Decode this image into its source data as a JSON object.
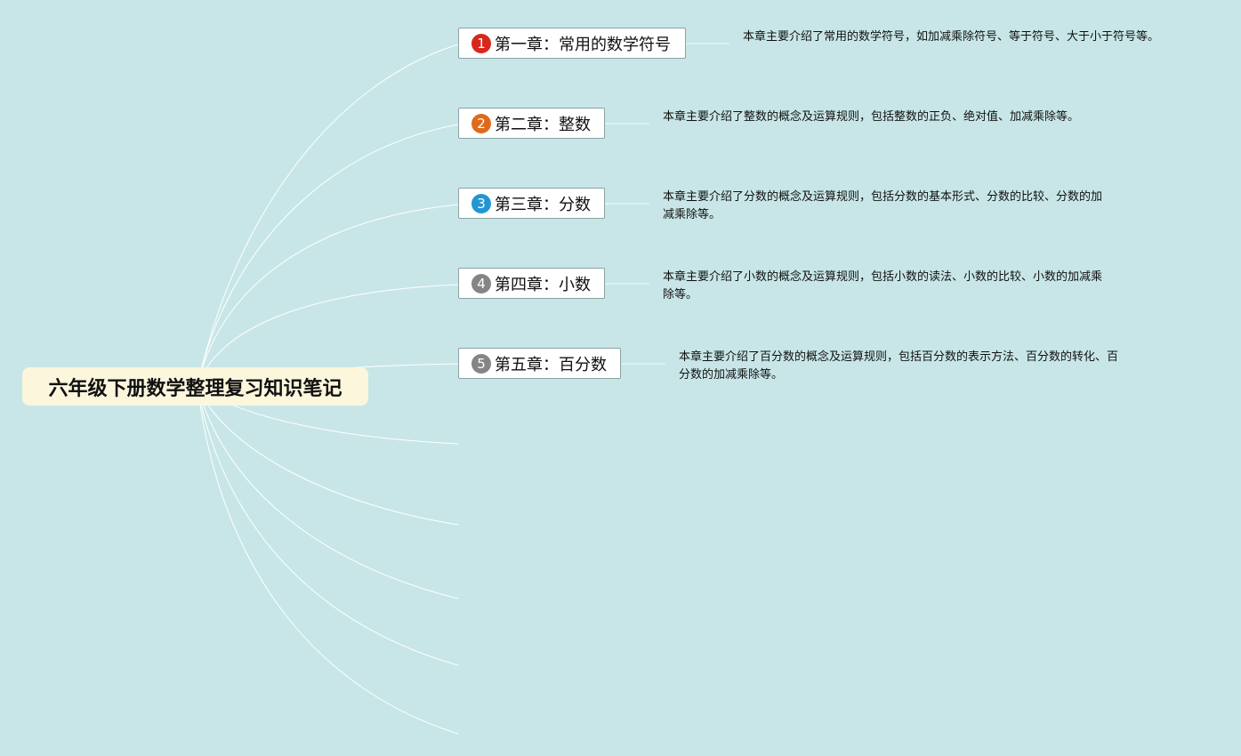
{
  "root": {
    "title": "六年级下册数学整理复习知识笔记"
  },
  "chapters": [
    {
      "number": "1",
      "title": "第一章：常用的数学符号",
      "badge_color": "#d8271c",
      "description": "本章主要介绍了常用的数学符号，如加减乘除符号、等于符号、大于小于符号等。"
    },
    {
      "number": "2",
      "title": "第二章：整数",
      "badge_color": "#e06a1b",
      "description": "本章主要介绍了整数的概念及运算规则，包括整数的正负、绝对值、加减乘除等。"
    },
    {
      "number": "3",
      "title": "第三章：分数",
      "badge_color": "#2196d3",
      "description": "本章主要介绍了分数的概念及运算规则，包括分数的基本形式、分数的比较、分数的加减乘除等。"
    },
    {
      "number": "4",
      "title": "第四章：小数",
      "badge_color": "#858585",
      "description": "本章主要介绍了小数的概念及运算规则，包括小数的读法、小数的比较、小数的加减乘除等。"
    },
    {
      "number": "5",
      "title": "第五章：百分数",
      "badge_color": "#858585",
      "description": "本章主要介绍了百分数的概念及运算规则，包括百分数的表示方法、百分数的转化、百分数的加减乘除等。"
    }
  ],
  "colors": {
    "background": "#c8e6e7",
    "root_fill": "#fbf6dc",
    "node_border": "#8aa3a5",
    "link": "#ffffff"
  }
}
